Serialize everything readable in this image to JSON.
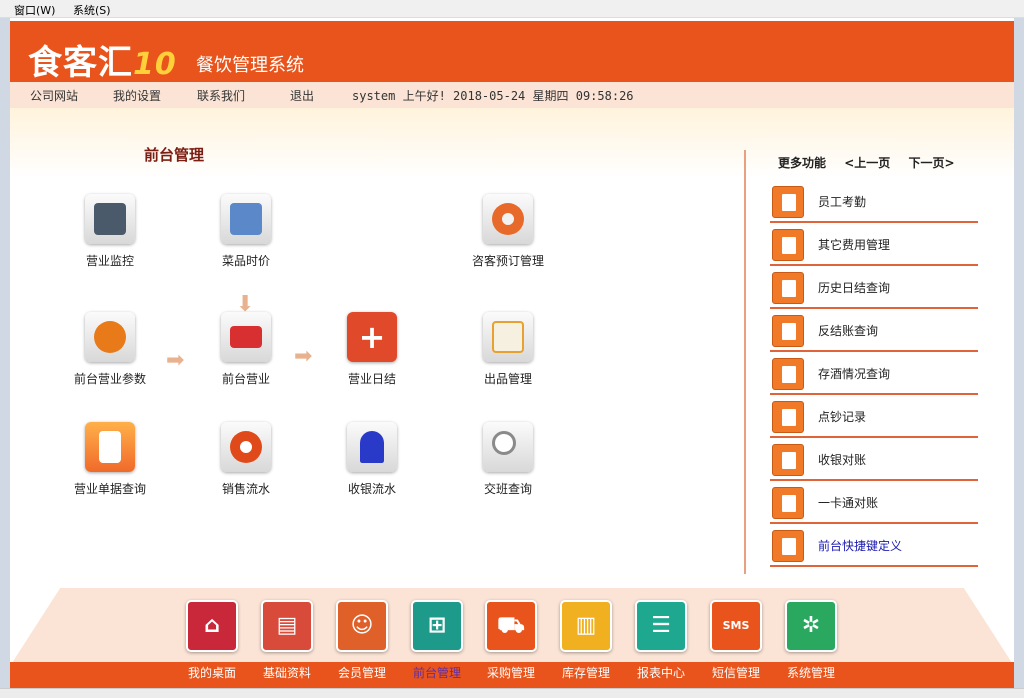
{
  "menubar": {
    "window": "窗口(W)",
    "system": "系统(S)"
  },
  "header": {
    "logo": "食客汇",
    "logo_suffix": "10",
    "app_title": "餐饮管理系统"
  },
  "nav": {
    "links": [
      "公司网站",
      "我的设置",
      "联系我们",
      "退出"
    ],
    "status": "system 上午好! 2018-05-24 星期四 09:58:26"
  },
  "section_title": "前台管理",
  "tiles": [
    {
      "label": "营业监控",
      "icon": "monitor-dollar-icon",
      "color": "#4a5a6a"
    },
    {
      "label": "菜品时价",
      "icon": "menu-window-icon",
      "color": "#5a88c8"
    },
    {
      "label": "咨客预订管理",
      "icon": "pie-document-icon",
      "color": "#e86a2a"
    },
    {
      "label": "前台营业参数",
      "icon": "gears-icon",
      "color": "#e87a1a"
    },
    {
      "label": "前台营业",
      "icon": "card-icon",
      "color": "#d83030"
    },
    {
      "label": "营业日结",
      "icon": "plus-icon",
      "color": "#e04a2a"
    },
    {
      "label": "出品管理",
      "icon": "document-arrow-icon",
      "color": "#e8a030"
    },
    {
      "label": "营业单据查询",
      "icon": "document-export-icon",
      "color": "#f06a2a"
    },
    {
      "label": "销售流水",
      "icon": "donut-chart-icon",
      "color": "#e04a1a"
    },
    {
      "label": "收银流水",
      "icon": "siren-icon",
      "color": "#2a3ac8"
    },
    {
      "label": "交班查询",
      "icon": "magnifier-icon",
      "color": "#8a8a8a"
    }
  ],
  "more": {
    "title": "更多功能",
    "prev": "<上一页",
    "next": "下一页>",
    "items": [
      "员工考勤",
      "其它费用管理",
      "历史日结查询",
      "反结账查询",
      "存酒情况查询",
      "点钞记录",
      "收银对账",
      "一卡通对账",
      "前台快捷键定义"
    ]
  },
  "dock": [
    {
      "label": "我的桌面",
      "color": "#c8283a",
      "glyph": "⌂"
    },
    {
      "label": "基础资料",
      "color": "#d84a3a",
      "glyph": "▤"
    },
    {
      "label": "会员管理",
      "color": "#e0602a",
      "glyph": "☺"
    },
    {
      "label": "前台管理",
      "color": "#1e9a8a",
      "glyph": "⊞"
    },
    {
      "label": "采购管理",
      "color": "#e8541b",
      "glyph": "⛟"
    },
    {
      "label": "库存管理",
      "color": "#f0b020",
      "glyph": "▥"
    },
    {
      "label": "报表中心",
      "color": "#1ea890",
      "glyph": "☰"
    },
    {
      "label": "短信管理",
      "color": "#e8541b",
      "glyph": "SMS"
    },
    {
      "label": "系统管理",
      "color": "#2aa860",
      "glyph": "✲"
    }
  ]
}
